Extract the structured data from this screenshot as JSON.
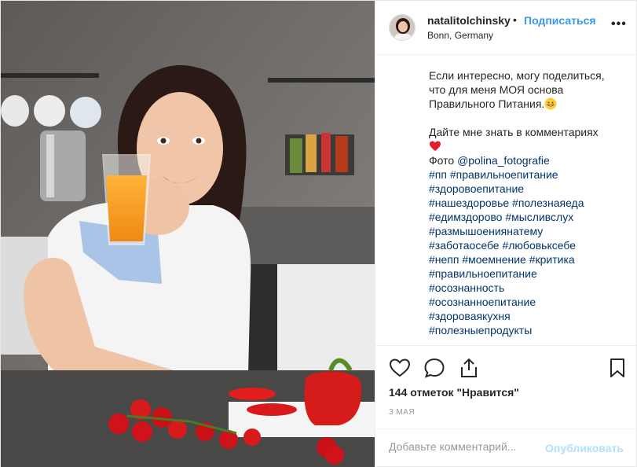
{
  "post": {
    "username": "natalitolchinsky",
    "separator": "•",
    "follow_label": "Подписаться",
    "location": "Bonn, Germany",
    "more_label": "•••"
  },
  "caption": {
    "lines": [
      "Если интересно, могу поделиться,",
      "что для меня МОЯ основа",
      "Правильного Питания."
    ],
    "lines2": [
      "Дайте мне знать в комментариях"
    ],
    "photo_prefix": "Фото ",
    "mention": "@polina_fotografie",
    "hashtags": [
      "#пп #правильноепитание",
      "#здоровоепитание",
      "#нашездоровье #полезнаяеда",
      "#едимздорово #мысливслух",
      "#размышоениянатему",
      "#заботаосебе #любовьксебе",
      "#непп #моемнение #критика",
      "#правильноепитание",
      "#осознанность",
      "#осознанноепитание",
      "#здороваякухня",
      "#полезныепродукты"
    ]
  },
  "stats": {
    "likes_text": "144 отметок \"Нравится\"",
    "date_text": "3 МАЯ"
  },
  "comment": {
    "placeholder": "Добавьте комментарий...",
    "publish_label": "Опубликовать"
  },
  "icons": {
    "like": "heart-icon",
    "comment": "speech-bubble-icon",
    "share": "share-icon",
    "save": "bookmark-icon",
    "emoji1": "grinning-face-emoji",
    "emoji2": "red-heart-emoji"
  },
  "colors": {
    "accent": "#3897f0",
    "link": "#003569",
    "publish_disabled": "#b2dffc",
    "muted": "#999999"
  }
}
